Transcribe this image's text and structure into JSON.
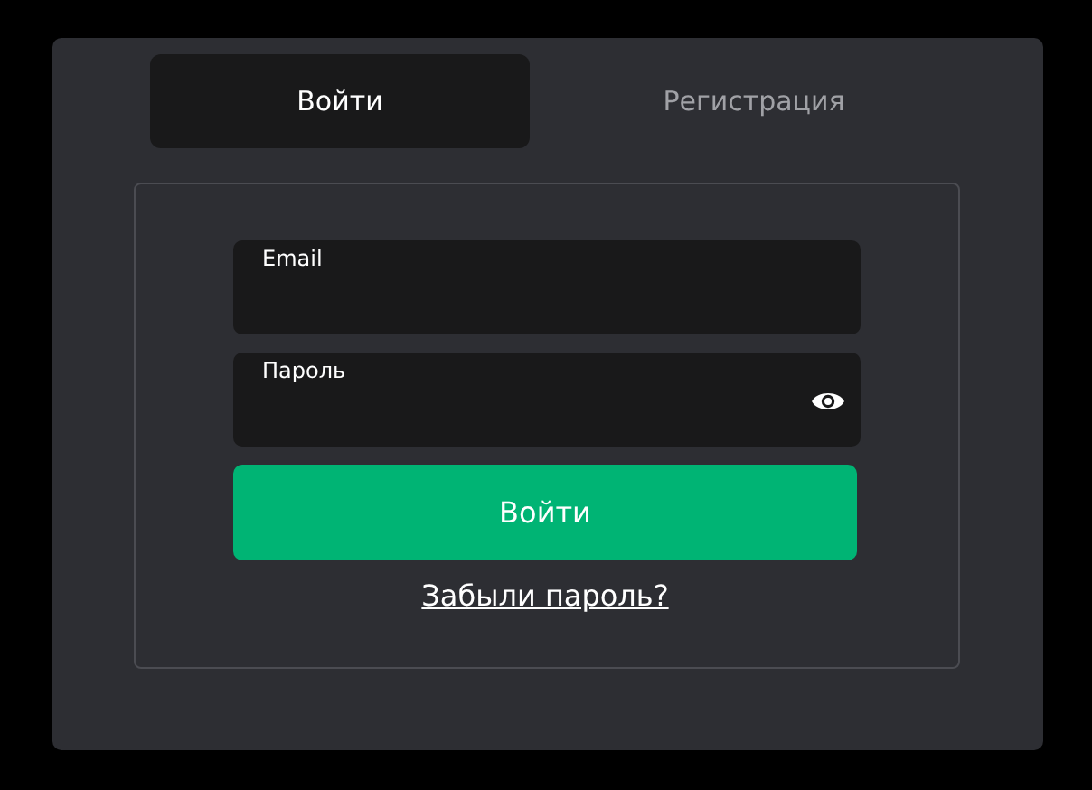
{
  "tabs": [
    {
      "label": "Войти",
      "selected": true
    },
    {
      "label": "Регистрация",
      "selected": false
    }
  ],
  "form": {
    "fields": [
      {
        "label": "Email",
        "kind": "text"
      },
      {
        "label": "Пароль",
        "kind": "password"
      }
    ],
    "submit_button": "Войти",
    "forgot_link": "Забыли пароль?"
  }
}
